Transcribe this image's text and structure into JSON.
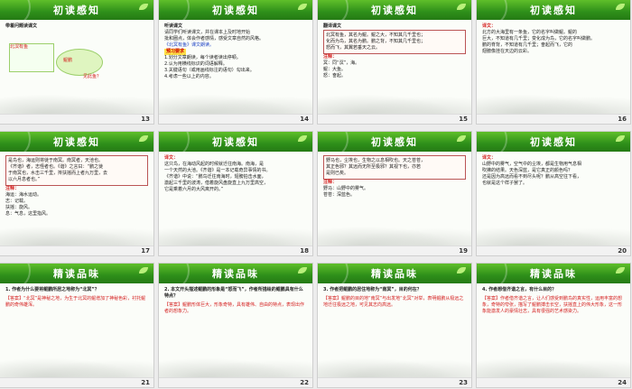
{
  "grid": {
    "slides": [
      {
        "num": "13",
        "title": "初读感知"
      },
      {
        "num": "14",
        "title": "初读感知"
      },
      {
        "num": "15",
        "title": "初读感知"
      },
      {
        "num": "16",
        "title": "初读感知"
      },
      {
        "num": "17",
        "title": "初读感知"
      },
      {
        "num": "18",
        "title": "初读感知"
      },
      {
        "num": "19",
        "title": "初读感知"
      },
      {
        "num": "20",
        "title": "初读感知"
      },
      {
        "num": "21",
        "title": "精读品味"
      },
      {
        "num": "22",
        "title": "精读品味"
      },
      {
        "num": "23",
        "title": "精读品味"
      },
      {
        "num": "24",
        "title": "精读品味"
      }
    ]
  },
  "s13": {
    "heading": "带着问题读课文",
    "a": "北溟有鱼",
    "b": "鲲鹏",
    "c": "见此鱼？"
  },
  "s14": {
    "heading": "听读课文",
    "line1": "请同学们听读课文，并在课本上及时地开始",
    "line2": "批和圈点，体会作者感情，感受文章自然的风格。",
    "link": "《北冥有鱼》课文朗读。",
    "req": "预习要求",
    "r1": "1.划分文章朗读，每个读者读出停顿。",
    "r2": "2.认为用横线标识的词语解释。",
    "r3": "3.关键语句（或用画线标注的语句）勾出来。",
    "r4": "4.考虑一些以上的内容。"
  },
  "s15": {
    "heading": "翻译课文",
    "l1": "北冥有鱼，其名为鲲。鲲之大，不知其几千里也；",
    "l2": "化而为鸟，其名为鹏。鹏之背，不知其几千里也；",
    "l3": "怒而飞，其翼若垂天之云。",
    "n": "注释：",
    "n1": "冥：同“溟”，海。",
    "n2": "鲲：大鱼。",
    "n3": "怒：奋起。"
  },
  "s16": {
    "heading": "译文：",
    "l1": "北方的大海里有一条鱼，它的名字叫做鲲。鲲的",
    "l2": "巨大，不知道有几千里；变化成为鸟，它的名字叫做鹏。",
    "l3": "鹏的脊背，不知道有几千里；奋起而飞，它的",
    "l4": "翅膀像挂在天边的云彩。"
  },
  "s17": {
    "l1": "是鸟也，海运则将徙于南冥。南冥者，天池也。",
    "l2": "《齐谐》者，志怪者也。《谐》之言曰：“鹏之徙",
    "l3": "于南冥也，水击三千里，抟扶摇而上者九万里，去",
    "l4": "以六月息者也。”",
    "n": "注释：",
    "n1": "海运：海水运动。",
    "n2": "志：记载。",
    "n3": "扶摇：旋风。",
    "n4": "息：气息，这里指风。"
  },
  "s18": {
    "heading": "译文：",
    "l1": "这只鸟，在海动风起的时候就迁往南海。南海，是",
    "l2": "一个天然的大池。《齐谐》是一本记载奇异事情的书。",
    "l3": "《齐谐》中说：“鹏鸟迁往南海时，翅膀拍击水面，",
    "l4": "激起三千里的波涛，借着旋风盘旋直上九万里高空，",
    "l5": "它是乘着六月的大风离开的。”"
  },
  "s19": {
    "l1": "野马也，尘埃也，生物之以息相吹也。天之苍苍，",
    "l2": "其正色邪？其远而无所至极邪？其视下也，亦若",
    "l3": "是则已矣。",
    "n": "注释：",
    "n1": "野马：山野中的雾气。",
    "n2": "苍苍：深蓝色。"
  },
  "s20": {
    "heading": "译文：",
    "l1": "山野中的雾气，空气中的尘埃，都是生物用气息相",
    "l2": "吹拂的结果。天色深蓝，是它真正的颜色吗？",
    "l3": "还是因为高远而看不到尽头呢？鹏从高空往下看，",
    "l4": "也就是这个样子罢了。"
  },
  "s21": {
    "q": "1. 作者为什么要将鲲鹏所居之地称为“北冥”？",
    "a": "【答案】“北冥”是神秘之地，为生于北冥的鲲增加了神秘色彩，衬托鲲鹏的奇伟雄浑。"
  },
  "s22": {
    "q": "2. 本文开头描述鲲鹏的形象是“怒而飞”，作者所描绘的鲲鹏具有什么特点？",
    "a": "【答案】鲲鹏形体巨大，形象奇特，具有雄伟、自由的特点，表现出作者的想象力。"
  },
  "s23": {
    "q": "3. 作者把鲲鹏的居住地称为“南冥”，目的何在？",
    "a": "【答案】鲲鹏的目的地“南冥”与出发地“北冥”对举，表明鲲鹏从极远之地迁往极远之地，可见其志向高远。"
  },
  "s24": {
    "q": "4. 作者想借齐谐之言，有什么目的？",
    "a": "【答案】作者借齐谐之言，让人们感受到鹏鸟的真实性，运用丰富的想象，奇特的夸张，描写了鲲鹏搏击长空，扶摇直上的伟大形象，这一形象能激发人的豪情壮志，具有很强的艺术感染力。"
  }
}
